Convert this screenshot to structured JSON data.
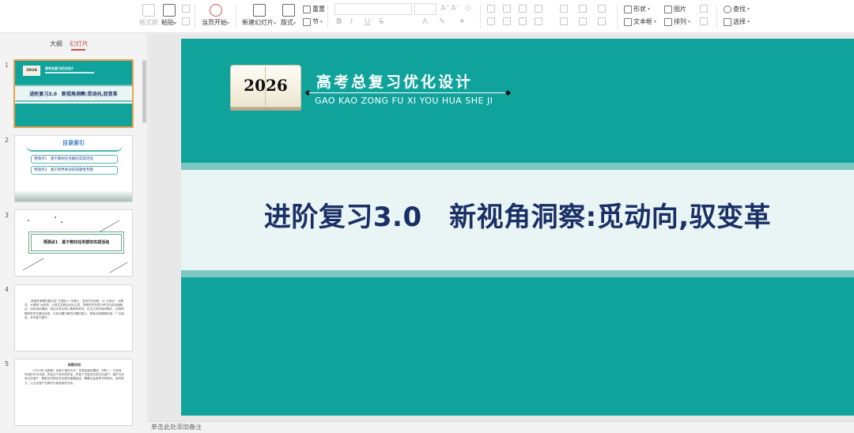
{
  "ribbon": {
    "format_painter": "格式刷",
    "paste": "粘贴",
    "start_slideshow": "当页开始",
    "new_slide": "新建幻灯片",
    "layout": "版式",
    "reset": "重置",
    "section": "节",
    "shape": "形状",
    "picture": "图片",
    "textbox": "文本框",
    "arrange": "排列",
    "find": "查找",
    "select": "选择",
    "font_glyphs": [
      "B",
      "I",
      "U",
      "S",
      "A"
    ]
  },
  "left_panel": {
    "tab_outline": "大纲",
    "tab_slides": "幻灯片",
    "slide_numbers": [
      "1",
      "2",
      "3",
      "4",
      "5"
    ],
    "thumb1": {
      "year": "2026",
      "brand": "高考总复习优化设计",
      "title": "进阶复习3.0　新视角洞察:觅动向,驭变革"
    },
    "thumb2": {
      "heading": "目录索引",
      "items": [
        "预测点1　基于教材任务群的实践活动",
        "预测点2　基于跨界阅读的辩题性专题"
      ]
    },
    "thumb3": {
      "box": "预测点1　基于教材任务群的实践活动"
    },
    "thumb4": {
      "text": "新高考命题的重点变“立德树人”为核心，坚持守正创新，以“大单元、大概念、大情境”为统领，以语文实践活动为主线，将教材任务群与考试内容深度融合，创设真实情境，突出对学生核心素养的考查。在近几年的高考题中，此类命题考查学生整合信息、分析问题与解决问题的能力，精准对接课程标准，广泛阅读，写作能力提升。"
    },
    "thumb5": {
      "heading": "典题体验",
      "text": "（2024年·全国卷）阅读下面的文字，完成后面的题目。材料一：古老而年轻的中华文明，历经五千多年的积淀，孕育了丰富多彩的文化遗产。保护与传承文化遗产，是推动文明交流互鉴的重要途径，需要社会各界共同参与、协同发力，让文化遗产在新时代焕发新的光彩。"
    }
  },
  "slide": {
    "year": "2026",
    "brand_cn": "高考总复习优化设计",
    "brand_pinyin": "GAO KAO ZONG FU XI YOU HUA SHE JI",
    "title": "进阶复习3.0　新视角洞察:觅动向,驭变革"
  },
  "notes": {
    "placeholder": "单击此处添加备注"
  },
  "colors": {
    "teal": "#10a39c",
    "band": "#e9f5f4",
    "band_border": "#7cc7c1",
    "title_navy": "#1a2f66",
    "active_tab": "#c0504d",
    "active_thumb_border": "#f0a04b"
  }
}
